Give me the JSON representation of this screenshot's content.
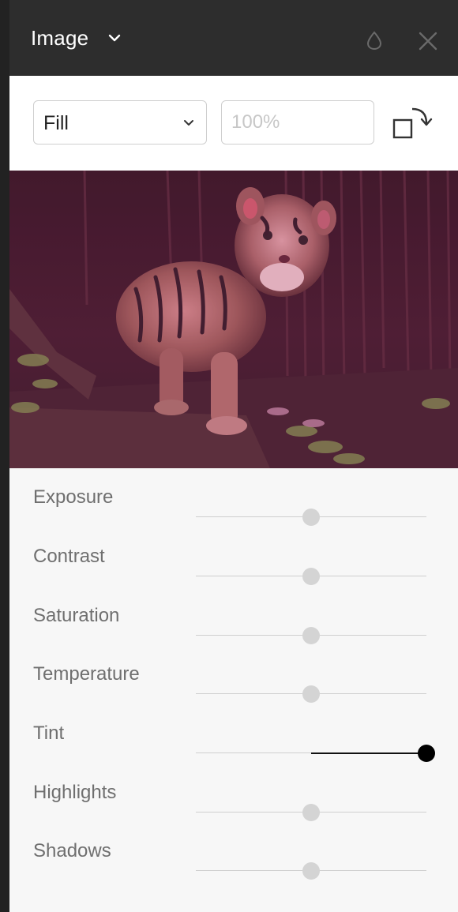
{
  "header": {
    "title": "Image",
    "chevron_icon": "chevron-down-icon",
    "drop_icon": "droplet-icon",
    "close_icon": "close-icon"
  },
  "toolbar": {
    "fill_mode": "Fill",
    "fill_options": [
      "Fill"
    ],
    "percent_placeholder": "100%",
    "percent_value": "",
    "rotate_icon": "rotate-icon"
  },
  "image": {
    "subject": "tiger cub photo",
    "tint_color": "#b04a7a"
  },
  "adjustments": [
    {
      "label": "Exposure",
      "value": 0.5
    },
    {
      "label": "Contrast",
      "value": 0.5
    },
    {
      "label": "Saturation",
      "value": 0.5
    },
    {
      "label": "Temperature",
      "value": 0.5
    },
    {
      "label": "Tint",
      "value": 1.0,
      "active": true
    },
    {
      "label": "Highlights",
      "value": 0.5
    },
    {
      "label": "Shadows",
      "value": 0.5
    }
  ],
  "colors": {
    "header_bg": "#2d2d2d",
    "panel_bg": "#f7f7f7",
    "active_slider": "#000000",
    "inactive_thumb": "#d4d4d4"
  }
}
